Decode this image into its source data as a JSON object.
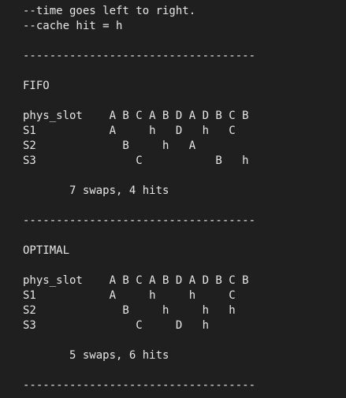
{
  "colors": {
    "background": "#1f1f1f",
    "text": "#e6e6e6"
  },
  "lines": [
    "--time goes left to right.",
    "--cache hit = h",
    "",
    "-----------------------------------",
    "",
    "FIFO",
    "",
    "phys_slot    A B C A B D A D B C B",
    "S1           A     h   D   h   C",
    "S2             B     h   A",
    "S3               C           B   h",
    "",
    "       7 swaps, 4 hits",
    "",
    "-----------------------------------",
    "",
    "OPTIMAL",
    "",
    "phys_slot    A B C A B D A D B C B",
    "S1           A     h     h     C",
    "S2             B     h     h   h",
    "S3               C     D   h",
    "",
    "       5 swaps, 6 hits",
    "",
    "-----------------------------------"
  ]
}
